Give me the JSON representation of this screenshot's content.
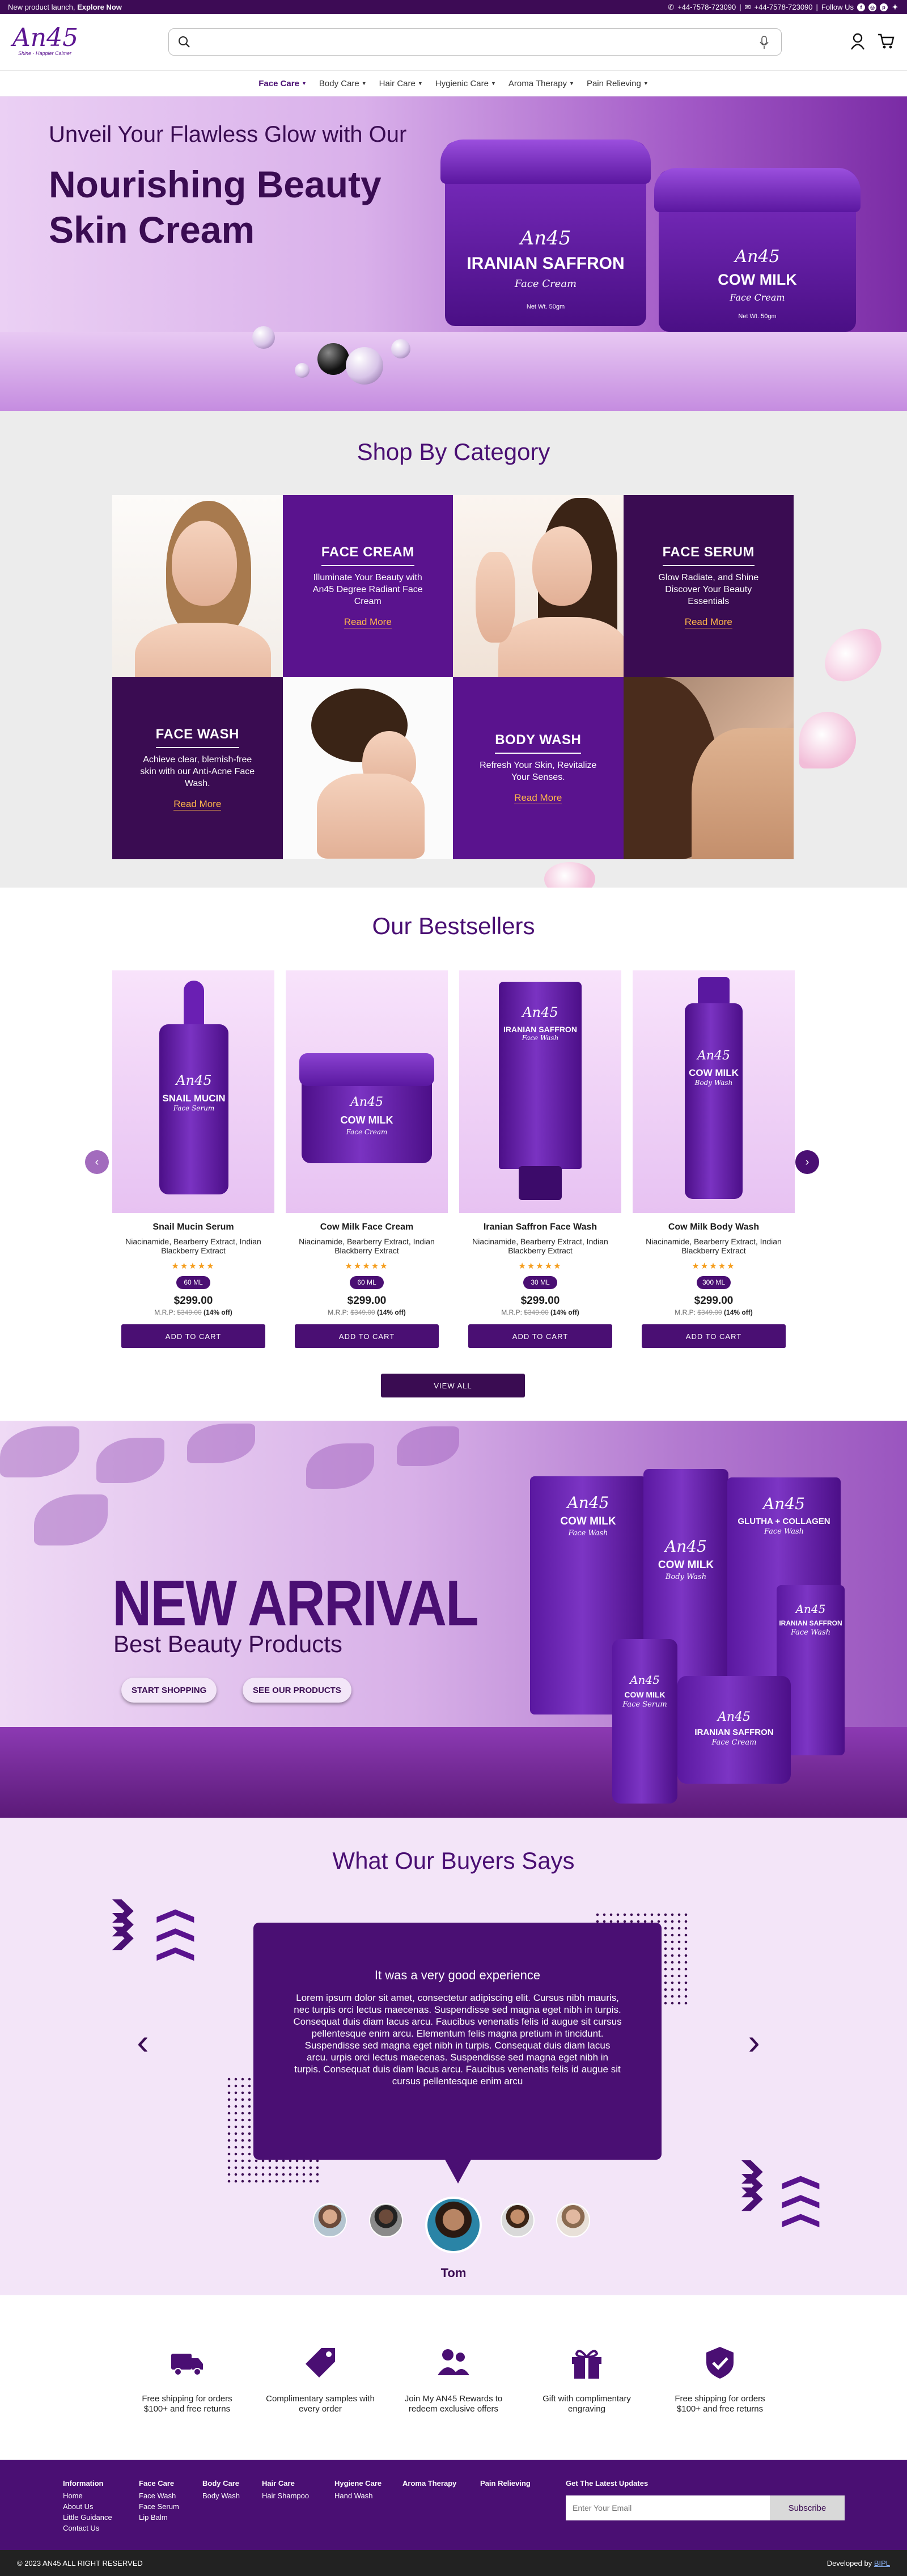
{
  "topbar": {
    "announcement": "New product launch,",
    "explore": "Explore Now",
    "phone": "+44-7578-723090",
    "email": "+44-7578-723090",
    "follow": "Follow Us"
  },
  "header": {
    "logo_text": "An45",
    "logo_tagline": "Shine · Happier Calmer",
    "search_placeholder": ""
  },
  "nav": [
    {
      "label": "Face Care"
    },
    {
      "label": "Body Care"
    },
    {
      "label": "Hair Care"
    },
    {
      "label": "Hygienic Care"
    },
    {
      "label": "Aroma Therapy"
    },
    {
      "label": "Pain Relieving"
    }
  ],
  "hero": {
    "subtitle": "Unveil Your Flawless Glow with Our",
    "title": "Nourishing Beauty Skin Cream",
    "jar1": {
      "brand": "An45",
      "name": "IRANIAN SAFFRON",
      "type": "Face Cream",
      "weight": "Net Wt. 50gm"
    },
    "jar2": {
      "brand": "An45",
      "name": "COW MILK",
      "type": "Face Cream",
      "weight": "Net Wt. 50gm"
    }
  },
  "category": {
    "title": "Shop By Category",
    "tiles": [
      {
        "title": "FACE CREAM",
        "text": "Illuminate Your Beauty with An45 Degree Radiant Face Cream",
        "link": "Read More"
      },
      {
        "title": "FACE SERUM",
        "text": "Glow Radiate, and Shine Discover Your Beauty Essentials",
        "link": "Read More"
      },
      {
        "title": "FACE WASH",
        "text": "Achieve clear, blemish-free skin with our Anti-Acne Face Wash.",
        "link": "Read More"
      },
      {
        "title": "BODY WASH",
        "text": "Refresh Your Skin, Revitalize Your Senses.",
        "link": "Read More"
      }
    ]
  },
  "bestsellers": {
    "title": "Our Bestsellers",
    "products": [
      {
        "name": "Snail Mucin Serum",
        "desc": "Niacinamide, Bearberry Extract, Indian Blackberry Extract",
        "stars": "★★★★★",
        "size": "60 ML",
        "price": "$299.00",
        "mrp_label": "M.R.P:",
        "mrp": "$349.00",
        "off": "(14% off)",
        "cta": "ADD TO CART",
        "label_brand": "An45",
        "label_name": "SNAIL MUCIN",
        "label_type": "Face Serum"
      },
      {
        "name": "Cow Milk Face Cream",
        "desc": "Niacinamide, Bearberry Extract, Indian Blackberry Extract",
        "stars": "★★★★★",
        "size": "60 ML",
        "price": "$299.00",
        "mrp_label": "M.R.P:",
        "mrp": "$349.00",
        "off": "(14% off)",
        "cta": "ADD TO CART",
        "label_brand": "An45",
        "label_name": "COW MILK",
        "label_type": "Face Cream"
      },
      {
        "name": "Iranian Saffron Face Wash",
        "desc": "Niacinamide, Bearberry Extract, Indian Blackberry Extract",
        "stars": "★★★★★",
        "size": "30 ML",
        "price": "$299.00",
        "mrp_label": "M.R.P:",
        "mrp": "$349.00",
        "off": "(14% off)",
        "cta": "ADD TO CART",
        "label_brand": "An45",
        "label_name": "IRANIAN SAFFRON",
        "label_type": "Face Wash"
      },
      {
        "name": "Cow Milk Body Wash",
        "desc": "Niacinamide, Bearberry Extract, Indian Blackberry Extract",
        "stars": "★★★★★",
        "size": "300 ML",
        "price": "$299.00",
        "mrp_label": "M.R.P:",
        "mrp": "$349.00",
        "off": "(14% off)",
        "cta": "ADD TO CART",
        "label_brand": "An45",
        "label_name": "COW MILK",
        "label_type": "Body Wash"
      }
    ],
    "view_all": "VIEW ALL"
  },
  "arrival": {
    "title": "NEW ARRIVAL",
    "subtitle": "Best Beauty Products",
    "btn_shop": "START SHOPPING",
    "btn_products": "SEE OUR PRODUCTS",
    "bottles": [
      {
        "brand": "An45",
        "name": "COW MILK",
        "type": "Face Wash"
      },
      {
        "brand": "An45",
        "name": "COW MILK",
        "type": "Body Wash"
      },
      {
        "brand": "An45",
        "name": "GLUTHA + COLLAGEN",
        "type": "Face Wash"
      },
      {
        "brand": "An45",
        "name": "IRANIAN SAFFRON",
        "type": "Face Wash"
      },
      {
        "brand": "An45",
        "name": "COW MILK",
        "type": "Face Serum"
      },
      {
        "brand": "An45",
        "name": "IRANIAN SAFFRON",
        "type": "Face Cream"
      }
    ]
  },
  "testimonials": {
    "title": "What Our Buyers Says",
    "quote_title": "It was a very good experience",
    "quote": "Lorem ipsum dolor sit amet, consectetur adipiscing elit. Cursus nibh mauris, nec turpis orci lectus maecenas. Suspendisse sed magna eget nibh in turpis. Consequat duis diam lacus arcu. Faucibus venenatis felis id augue sit cursus pellentesque enim arcu. Elementum felis magna pretium in tincidunt. Suspendisse sed magna eget nibh in turpis. Consequat duis diam lacus arcu. urpis orci lectus maecenas. Suspendisse sed magna eget nibh in turpis. Consequat duis diam lacus arcu. Faucibus venenatis felis id augue sit cursus pellentesque enim arcu",
    "name": "Tom"
  },
  "features": [
    {
      "icon": "truck-icon",
      "text": "Free shipping for orders $100+ and free returns"
    },
    {
      "icon": "tag-icon",
      "text": "Complimentary samples with every order"
    },
    {
      "icon": "users-icon",
      "text": "Join My AN45 Rewards to redeem exclusive offers"
    },
    {
      "icon": "gift-icon",
      "text": "Gift with complimentary engraving"
    },
    {
      "icon": "shield-check-icon",
      "text": "Free shipping for orders $100+ and free returns"
    }
  ],
  "footer": {
    "columns": [
      {
        "title": "Information",
        "links": [
          "Home",
          "About Us",
          "Little Guidance",
          "Contact Us"
        ]
      },
      {
        "title": "Face Care",
        "links": [
          "Face Wash",
          "Face Serum",
          "Lip Balm"
        ]
      },
      {
        "title": "Body Care",
        "links": [
          "Body Wash"
        ]
      },
      {
        "title": "Hair Care",
        "links": [
          "Hair Shampoo"
        ]
      },
      {
        "title": "Hygiene Care",
        "links": [
          "Hand Wash"
        ]
      },
      {
        "title": "Aroma Therapy",
        "links": []
      },
      {
        "title": "Pain Relieving",
        "links": []
      }
    ],
    "newsletter_title": "Get The Latest Updates",
    "email_placeholder": "Enter Your Email",
    "subscribe": "Subscribe",
    "copyright": "© 2023 AN45 ALL RIGHT RESERVED",
    "developed_by": "Developed by",
    "developer": "BIPL"
  },
  "colors": {
    "primary": "#4a0f73",
    "dark": "#3a0c52",
    "accent": "#ffb74a",
    "star": "#f59d1c"
  }
}
